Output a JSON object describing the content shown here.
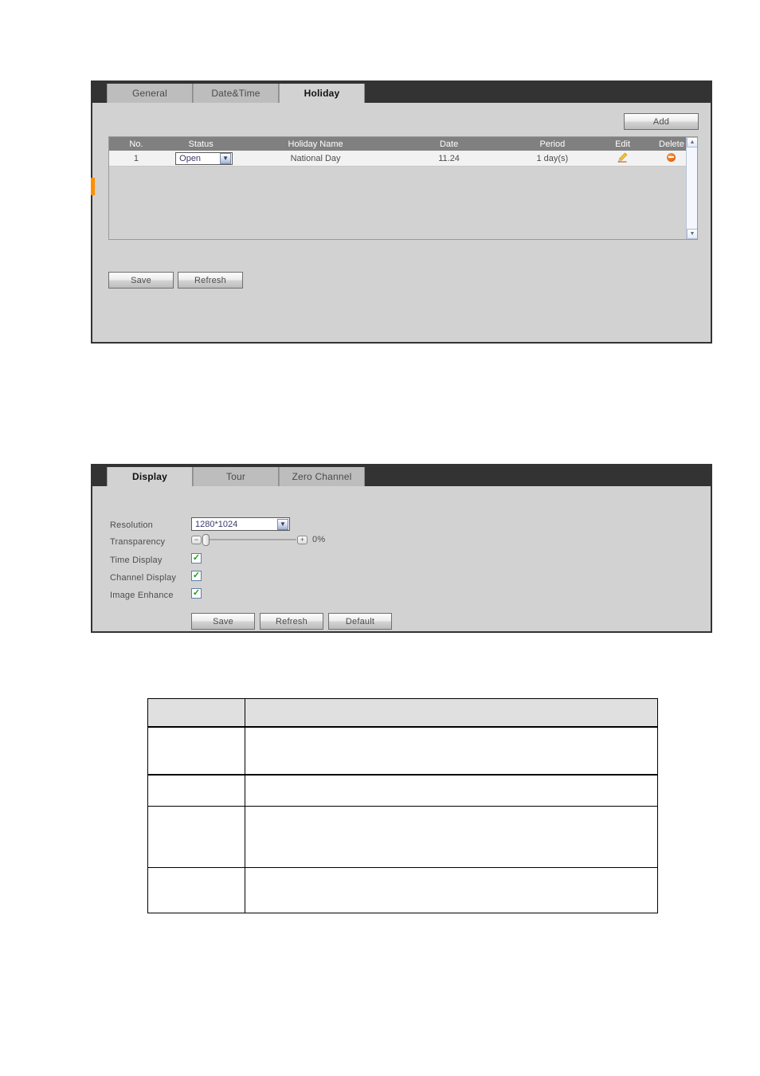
{
  "holiday_panel": {
    "tabs": [
      {
        "label": "General",
        "active": false
      },
      {
        "label": "Date&Time",
        "active": false
      },
      {
        "label": "Holiday",
        "active": true
      }
    ],
    "add_button": "Add",
    "table": {
      "columns": [
        "No.",
        "Status",
        "Holiday Name",
        "Date",
        "Period",
        "Edit",
        "Delete"
      ],
      "rows": [
        {
          "no": "1",
          "status": "Open",
          "name": "National Day",
          "date": "11.24",
          "period": "1 day(s)",
          "edit_icon": "pencil-icon",
          "delete_icon": "minus-circle-icon"
        }
      ]
    },
    "scrollbar": {
      "up_icon": "▲",
      "down_icon": "▼"
    },
    "buttons": [
      "Save",
      "Refresh"
    ]
  },
  "display_panel": {
    "tabs": [
      {
        "label": "Display",
        "active": true
      },
      {
        "label": "Tour",
        "active": false
      },
      {
        "label": "Zero Channel",
        "active": false
      }
    ],
    "fields": {
      "resolution": {
        "label": "Resolution",
        "value": "1280*1024"
      },
      "transparency": {
        "label": "Transparency",
        "value": "0%",
        "minus_icon": "minus-icon",
        "plus_icon": "plus-icon",
        "position_percent": 0
      },
      "time_display": {
        "label": "Time Display",
        "checked": true,
        "check_glyph": "✓"
      },
      "channel_display": {
        "label": "Channel Display",
        "checked": true,
        "check_glyph": "✓"
      },
      "image_enhance": {
        "label": "Image Enhance",
        "checked": true,
        "check_glyph": "✓"
      }
    },
    "buttons": [
      "Save",
      "Refresh",
      "Default"
    ]
  },
  "doc_table": {
    "header": [
      "",
      ""
    ],
    "rows": [
      [
        "",
        ""
      ],
      [
        "",
        ""
      ],
      [
        "",
        ""
      ],
      [
        "",
        ""
      ]
    ]
  },
  "colors": {
    "panel_bg": "#d2d2d2",
    "tabbar_bg": "#333333",
    "grid_header_bg": "#808080",
    "row_bg": "#f2f2f2",
    "accent_orange": "#ff8f00",
    "delete_orange": "#e8640c",
    "check_green": "#1a9b1a"
  }
}
